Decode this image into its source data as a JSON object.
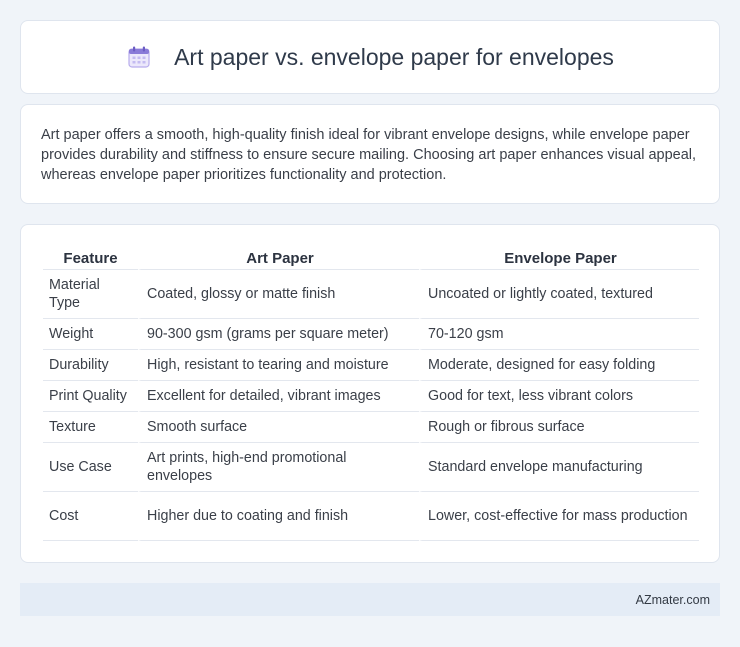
{
  "header": {
    "icon": "calendar-icon",
    "title": "Art paper vs. envelope paper for envelopes"
  },
  "summary": {
    "text": "Art paper offers a smooth, high-quality finish ideal for vibrant envelope designs, while envelope paper provides durability and stiffness to ensure secure mailing. Choosing art paper enhances visual appeal, whereas envelope paper prioritizes functionality and protection."
  },
  "table": {
    "headers": [
      "Feature",
      "Art Paper",
      "Envelope Paper"
    ],
    "rows": [
      [
        "Material Type",
        "Coated, glossy or matte finish",
        "Uncoated or lightly coated, textured"
      ],
      [
        "Weight",
        "90-300 gsm (grams per square meter)",
        "70-120 gsm"
      ],
      [
        "Durability",
        "High, resistant to tearing and moisture",
        "Moderate, designed for easy folding"
      ],
      [
        "Print Quality",
        "Excellent for detailed, vibrant images",
        "Good for text, less vibrant colors"
      ],
      [
        "Texture",
        "Smooth surface",
        "Rough or fibrous surface"
      ],
      [
        "Use Case",
        "Art prints, high-end promotional envelopes",
        "Standard envelope manufacturing"
      ],
      [
        "Cost",
        "Higher due to coating and finish",
        "Lower, cost-effective for mass production"
      ]
    ]
  },
  "footer": {
    "text": "AZmater.com"
  },
  "colors": {
    "background": "#f0f4f9",
    "card": "#ffffff",
    "footer_bg": "#e4ecf6",
    "icon_accent": "#8a7bd8"
  }
}
